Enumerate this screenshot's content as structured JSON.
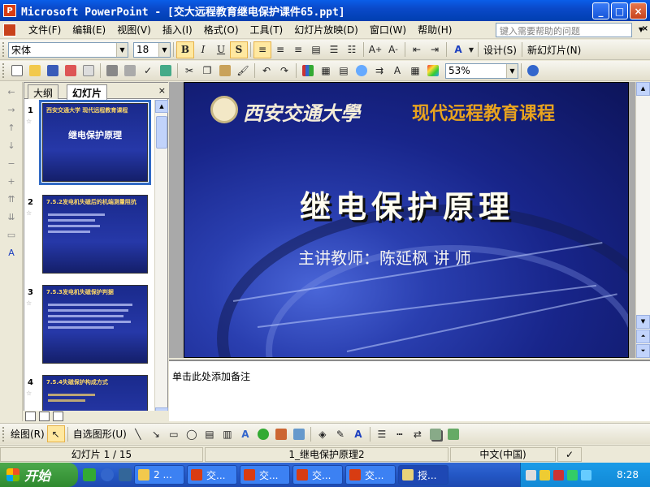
{
  "window": {
    "title": "Microsoft PowerPoint - [交大远程教育继电保护课件65.ppt]",
    "buttons": [
      "_",
      "□",
      "×"
    ]
  },
  "menu": {
    "items": [
      "文件(F)",
      "编辑(E)",
      "视图(V)",
      "插入(I)",
      "格式(O)",
      "工具(T)",
      "幻灯片放映(D)",
      "窗口(W)",
      "帮助(H)"
    ],
    "help_placeholder": "键入需要帮助的问题",
    "close": "×"
  },
  "format_toolbar": {
    "font": "宋体",
    "size": "18",
    "bold": "B",
    "italic": "I",
    "underline": "U",
    "shadow": "S",
    "design": "设计(S)",
    "new_slide": "新幻灯片(N)"
  },
  "standard_toolbar": {
    "zoom": "53%"
  },
  "slides_panel": {
    "tab_outline": "大纲",
    "tab_slides": "幻灯片",
    "close": "×",
    "thumbnails": [
      {
        "num": "1",
        "title": "西安交通大学  现代远程教育课程",
        "main": "继电保护原理",
        "selected": true
      },
      {
        "num": "2",
        "title": "7.5.2发电机失磁后的机端测量阻抗",
        "main": "",
        "selected": false
      },
      {
        "num": "3",
        "title": "7.5.3发电机失磁保护判据",
        "main": "",
        "selected": false
      },
      {
        "num": "4",
        "title": "7.5.4失磁保护构成方式",
        "main": "",
        "selected": false
      }
    ]
  },
  "slide": {
    "school": "西安交通大學",
    "program": "现代远程教育课程",
    "title": "继电保护原理",
    "lecturer": "主讲教师：陈延枫   讲 师"
  },
  "notes": {
    "placeholder": "单击此处添加备注"
  },
  "draw_toolbar": {
    "draw": "绘图(R)",
    "autoshapes": "自选图形(U)"
  },
  "status": {
    "slide_pos": "幻灯片 1 / 15",
    "design": "1_继电保护原理2",
    "language": "中文(中国)"
  },
  "taskbar": {
    "start": "开始",
    "tasks": [
      "2 ...",
      "交...",
      "交...",
      "交...",
      "交...",
      "授..."
    ],
    "clock": "8:28"
  },
  "colors": {
    "title_bar": "#0a49c9",
    "slide_bg": "#18258a",
    "slide_title": "#fffdf0",
    "program_text": "#e8a31e",
    "taskbar": "#2457c5",
    "start_button": "#3c963c"
  }
}
